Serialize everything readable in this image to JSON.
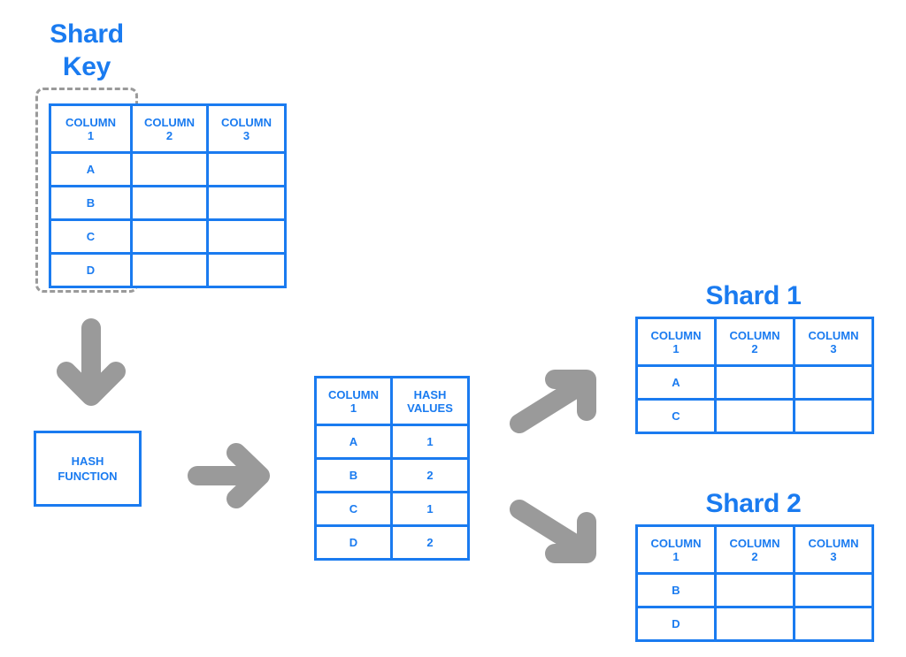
{
  "diagram": {
    "title_shard_key": "Shard\nKey",
    "title_shard_1": "Shard 1",
    "title_shard_2": "Shard 2",
    "hash_function_label": "HASH\nFUNCTION",
    "accent_color": "#1a7bf0",
    "arrow_color": "#9a9a9a",
    "dash_color": "#9a9a9a"
  },
  "source_table": {
    "headers": [
      "COLUMN\n1",
      "COLUMN\n2",
      "COLUMN\n3"
    ],
    "rows": [
      [
        "A",
        "",
        ""
      ],
      [
        "B",
        "",
        ""
      ],
      [
        "C",
        "",
        ""
      ],
      [
        "D",
        "",
        ""
      ]
    ]
  },
  "hash_table": {
    "headers": [
      "COLUMN\n1",
      "HASH\nVALUES"
    ],
    "rows": [
      [
        "A",
        "1"
      ],
      [
        "B",
        "2"
      ],
      [
        "C",
        "1"
      ],
      [
        "D",
        "2"
      ]
    ]
  },
  "shard1_table": {
    "headers": [
      "COLUMN\n1",
      "COLUMN\n2",
      "COLUMN\n3"
    ],
    "rows": [
      [
        "A",
        "",
        ""
      ],
      [
        "C",
        "",
        ""
      ]
    ]
  },
  "shard2_table": {
    "headers": [
      "COLUMN\n1",
      "COLUMN\n2",
      "COLUMN\n3"
    ],
    "rows": [
      [
        "B",
        "",
        ""
      ],
      [
        "D",
        "",
        ""
      ]
    ]
  },
  "arrows": [
    {
      "name": "arrow-down-to-hash",
      "direction": "down"
    },
    {
      "name": "arrow-right-to-hash-table",
      "direction": "right"
    },
    {
      "name": "arrow-up-right-to-shard-1",
      "direction": "up-right"
    },
    {
      "name": "arrow-down-right-to-shard-2",
      "direction": "down-right"
    }
  ]
}
